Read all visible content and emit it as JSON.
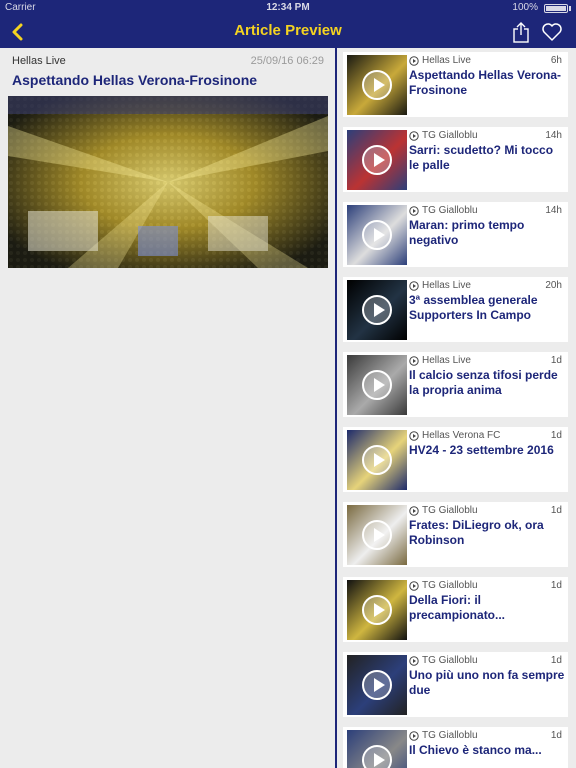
{
  "status": {
    "carrier": "Carrier",
    "time": "12:34 PM",
    "battery": "100%"
  },
  "nav": {
    "title": "Article Preview"
  },
  "article": {
    "source": "Hellas Live",
    "date": "25/09/16 06:29",
    "title": "Aspettando Hellas Verona-Frosinone"
  },
  "feed": [
    {
      "source": "Hellas Live",
      "time": "6h",
      "title": "Aspettando Hellas Verona-Frosinone"
    },
    {
      "source": "TG Gialloblu",
      "time": "14h",
      "title": "Sarri: scudetto? Mi tocco le palle"
    },
    {
      "source": "TG Gialloblu",
      "time": "14h",
      "title": "Maran: primo tempo negativo"
    },
    {
      "source": "Hellas Live",
      "time": "20h",
      "title": "3ª assemblea generale Supporters In Campo"
    },
    {
      "source": "Hellas Live",
      "time": "1d",
      "title": "Il calcio senza tifosi perde la propria anima"
    },
    {
      "source": "Hellas Verona FC",
      "time": "1d",
      "title": "HV24 - 23 settembre 2016"
    },
    {
      "source": "TG Gialloblu",
      "time": "1d",
      "title": "Frates: DiLiegro ok, ora Robinson"
    },
    {
      "source": "TG Gialloblu",
      "time": "1d",
      "title": "Della Fiori: il precampionato..."
    },
    {
      "source": "TG Gialloblu",
      "time": "1d",
      "title": "Uno più uno non fa sempre due"
    },
    {
      "source": "TG Gialloblu",
      "time": "1d",
      "title": "Il Chievo è stanco ma..."
    }
  ],
  "colors": {
    "brand": "#1d2679",
    "accent": "#f4d321",
    "background": "#ececec"
  }
}
